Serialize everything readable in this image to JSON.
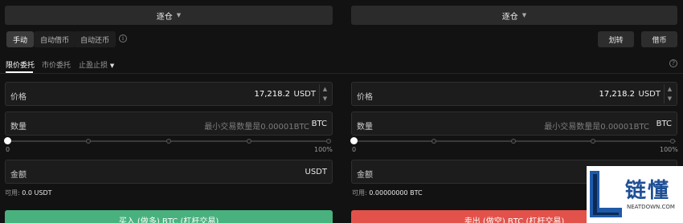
{
  "left": {
    "margin_dropdown": "逐仓",
    "mode_tabs": [
      "手动",
      "自动借币",
      "自动还币"
    ],
    "order_tabs": [
      "限价委托",
      "市价委托",
      "止盈止损"
    ],
    "price": {
      "label": "价格",
      "value": "17,218.2",
      "unit": "USDT"
    },
    "quantity": {
      "label": "数量",
      "placeholder": "最小交易数量是0.00001BTC",
      "unit": "BTC"
    },
    "slider": {
      "min_label": "0",
      "max_label": "100%",
      "level": 0
    },
    "amount": {
      "label": "金额",
      "unit": "USDT"
    },
    "available_label": "可用:",
    "available_value": "0.0 USDT",
    "buy_button": "买入 (做多) BTC (杠杆交易)"
  },
  "right": {
    "margin_dropdown": "逐仓",
    "transfer_button": "划转",
    "borrow_button": "借币",
    "price": {
      "label": "价格",
      "value": "17,218.2",
      "unit": "USDT"
    },
    "quantity": {
      "label": "数量",
      "placeholder": "最小交易数量是0.00001BTC",
      "unit": "BTC"
    },
    "slider": {
      "min_label": "0",
      "max_label": "100%",
      "level": 0
    },
    "amount": {
      "label": "金额"
    },
    "available_label": "可用:",
    "available_value": "0.00000000 BTC",
    "sell_button": "卖出 (做空) BTC (杠杆交易)"
  },
  "watermark": {
    "brand": "链懂",
    "url": "NEATDOWN.COM"
  },
  "colors": {
    "buy": "#49b17e",
    "sell": "#e2524b",
    "background": "#121212"
  }
}
